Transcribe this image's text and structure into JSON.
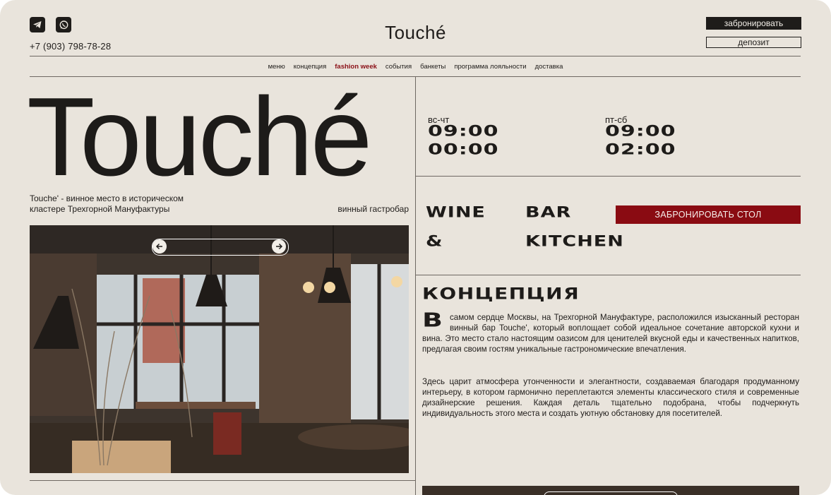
{
  "header": {
    "brand": "Touché",
    "phone": "+7 (903) 798-78-28",
    "book_label": "забронировать",
    "deposit_label": "депозит",
    "social": [
      {
        "name": "telegram-icon"
      },
      {
        "name": "whatsapp-icon"
      }
    ]
  },
  "nav": {
    "items": [
      {
        "label": "меню",
        "active": false
      },
      {
        "label": "концепция",
        "active": false
      },
      {
        "label": "fashion week",
        "active": true
      },
      {
        "label": "события",
        "active": false
      },
      {
        "label": "банкеты",
        "active": false
      },
      {
        "label": "программа лояльности",
        "active": false
      },
      {
        "label": "доставка",
        "active": false
      }
    ]
  },
  "hero": {
    "title": "Touché",
    "description": "Touche' - винное место в историческом кластере Трехгорной Мануфактуры",
    "tag": "винный гастробар",
    "prev_icon": "arrow-left-icon",
    "next_icon": "arrow-right-icon"
  },
  "schedule": {
    "weekdays": {
      "label": "вс-чт",
      "open": "09:00",
      "close": "00:00"
    },
    "weekend": {
      "label": "пт-сб",
      "open": "09:00",
      "close": "02:00"
    }
  },
  "bar": {
    "line1_a": "WINE",
    "line1_b": "BAR",
    "line2_a": "&",
    "line2_b": "KITCHEN",
    "book_table_label": "ЗАБРОНИРОВАТЬ СТОЛ"
  },
  "concept": {
    "title": "КОНЦЕПЦИЯ",
    "dropcap": "В",
    "p1": "самом сердце Москвы, на Трехгорной Мануфактуре, расположился изысканный ресторан винный бар Touche', который воплощает собой идеальное сочетание авторской кухни и вина. Это место стало настоящим оазисом для ценителей вкусной еды и качественных напитков, предлагая своим гостям уникальные гастрономические впечатления.",
    "p2": "Здесь царит атмосфера утонченности и элегантности, создаваемая благодаря продуманному интерьеру, в котором гармонично переплетаются элементы классического стиля и современные дизайнерские решения. Каждая деталь тщательно подобрана, чтобы подчеркнуть индивидуальность этого места и создать уютную обстановку для посетителей."
  },
  "colors": {
    "background": "#e9e4dc",
    "text": "#1e1c1a",
    "accent": "#8a0b12"
  }
}
